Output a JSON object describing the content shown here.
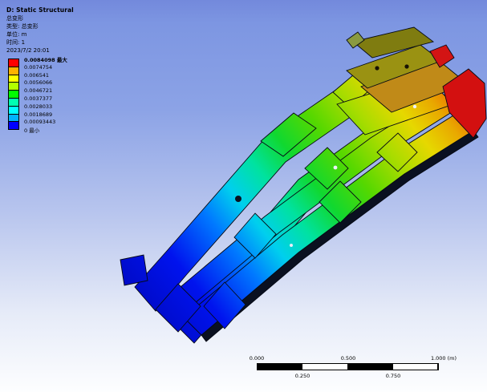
{
  "header": {
    "title": "D: Static Structural",
    "result_name": "总变形",
    "type_line": "类型: 总变形",
    "unit_line": "单位: m",
    "time_line": "时间: 1",
    "date_line": "2023/7/2 20:01"
  },
  "legend": {
    "labels": [
      "0.0084098 最大",
      "0.0074754",
      "0.006541",
      "0.0056066",
      "0.0046721",
      "0.0037377",
      "0.0028033",
      "0.0018689",
      "0.00093443",
      "0 最小"
    ],
    "colors": [
      "#ff0000",
      "#ffb200",
      "#ffff00",
      "#b2ff00",
      "#00ff00",
      "#00ffb2",
      "#00ffff",
      "#00b2ff",
      "#0000ff"
    ]
  },
  "scale_bar": {
    "top_labels": [
      "0.000",
      "0.500",
      "1.000 (m)"
    ],
    "bottom_labels": [
      "0.250",
      "0.750"
    ]
  },
  "model": {
    "colorbar_max": "0.0084098",
    "colorbar_min": "0",
    "unit": "m",
    "min_color": "#0000ff",
    "max_color": "#ff0000"
  }
}
